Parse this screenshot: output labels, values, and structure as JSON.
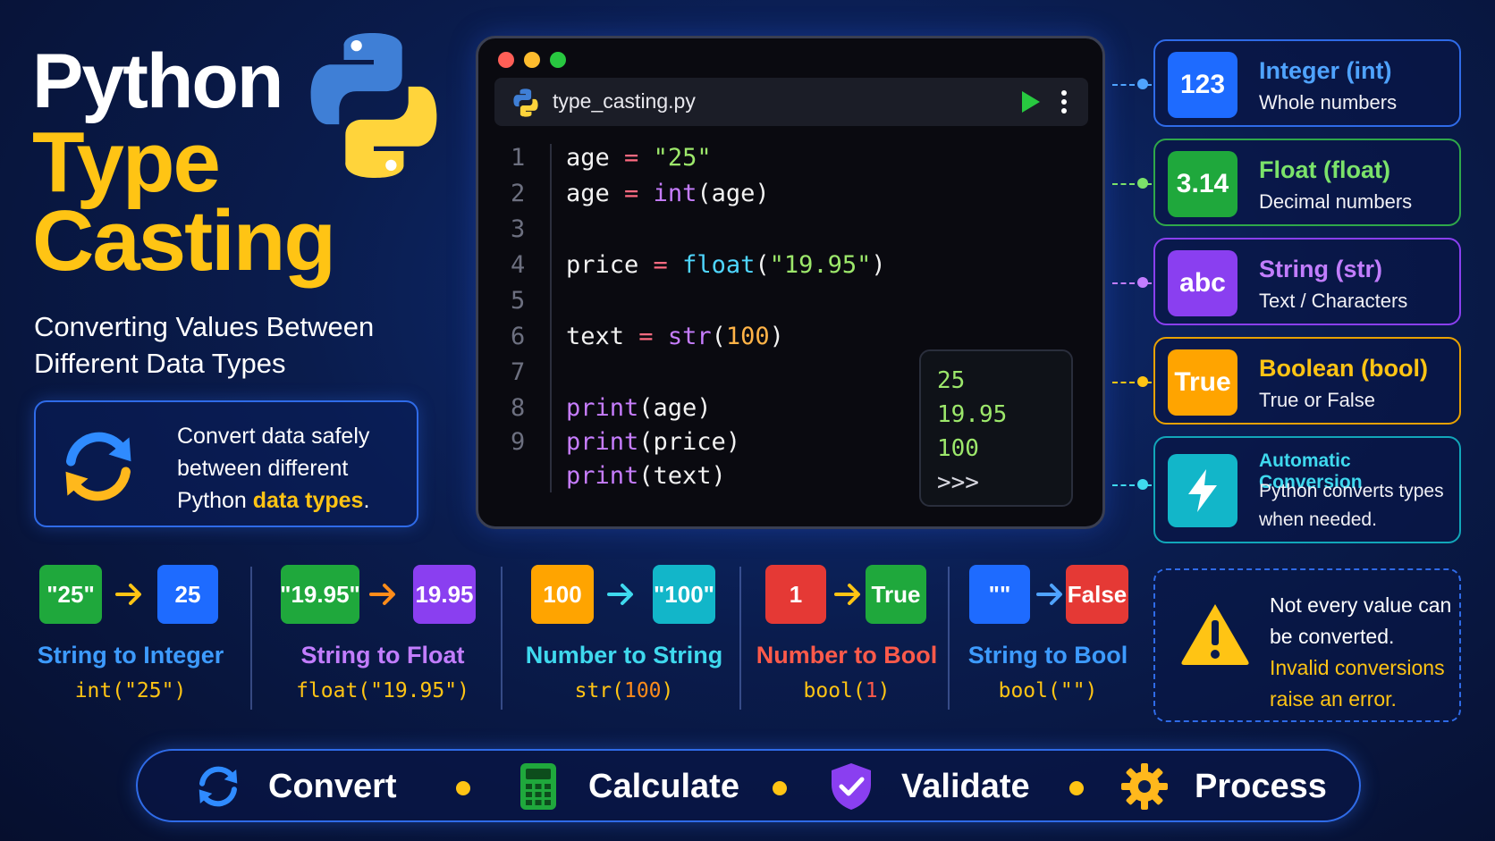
{
  "hero": {
    "title_line1": "Python",
    "title_line2": "Type",
    "title_line3": "Casting",
    "subtitle": "Converting Values Between Different Data Types",
    "info_pre": "Convert data safely between different Python ",
    "info_highlight": "data types",
    "info_post": ".",
    "logo_icon": "python-logo-icon",
    "sync_icon": "sync-arrows-icon"
  },
  "editor": {
    "filename": "type_casting.py",
    "line_numbers": [
      "1",
      "2",
      "3",
      "4",
      "5",
      "6",
      "7",
      "8",
      "9"
    ],
    "code": {
      "l1_var": "age",
      "l1_op": " = ",
      "l1_val": "\"25\"",
      "l2_var": "age",
      "l2_op": " = ",
      "l2_fn": "int",
      "l2_arg": "(age)",
      "l4_var": "price",
      "l4_op": " = ",
      "l4_fn": "float",
      "l4_open": "(",
      "l4_val": "\"19.95\"",
      "l4_close": ")",
      "l6_var": "text",
      "l6_op": " = ",
      "l6_fn": "str",
      "l6_open": "(",
      "l6_val": "100",
      "l6_close": ")",
      "l8_fn": "print",
      "l8_arg": "(age)",
      "l9_fn": "print",
      "l9_arg": "(price)",
      "l10_fn": "print",
      "l10_arg": "(text)"
    },
    "output": [
      "25",
      "19.95",
      "100",
      ">>>"
    ],
    "window_dots": [
      "#ff5f57",
      "#febc2e",
      "#28c840"
    ]
  },
  "types": [
    {
      "badge": "123",
      "name": "Integer (int)",
      "desc": "Whole numbers",
      "color": "#1e6bff",
      "accent": "#4fa3ff"
    },
    {
      "badge": "3.14",
      "name": "Float (float)",
      "desc": "Decimal numbers",
      "color": "#1fa83c",
      "accent": "#7be26a"
    },
    {
      "badge": "abc",
      "name": "String (str)",
      "desc": "Text / Characters",
      "color": "#8a3ff0",
      "accent": "#c27dff"
    },
    {
      "badge": "True",
      "name": "Boolean (bool)",
      "desc": "True or False",
      "color": "#ffa400",
      "accent": "#ffc414"
    },
    {
      "name": "Automatic Conversion",
      "desc1": "Python converts types",
      "desc2": "when needed.",
      "color": "#12b6c9",
      "accent": "#3fd9ee",
      "icon": "lightning-icon"
    }
  ],
  "conversions": [
    {
      "from": "\"25\"",
      "to": "25",
      "label": "String to Integer",
      "code": "int(\"25\")",
      "label_color": "#3d9bff"
    },
    {
      "from": "\"19.95\"",
      "to": "19.95",
      "label": "String to Float",
      "code": "float(\"19.95\")",
      "label_color": "#c27dff"
    },
    {
      "from": "100",
      "to": "\"100\"",
      "label": "Number to String",
      "code_fn": "str(",
      "code_arg": "100",
      "code_close": ")",
      "label_color": "#3fd9ee"
    },
    {
      "from": "1",
      "to": "True",
      "label": "Number to Bool",
      "code_fn": "bool(",
      "code_arg": "1",
      "code_close": ")",
      "label_color": "#ff5a4a"
    },
    {
      "from": "\"\"",
      "to": "False",
      "label": "String to Bool",
      "code": "bool(\"\")",
      "label_color": "#3d9bff"
    }
  ],
  "warning": {
    "line1": "Not every value can be converted.",
    "line2": "Invalid conversions raise an error.",
    "icon": "warning-triangle-icon"
  },
  "bottom_bar": [
    {
      "label": "Convert",
      "icon": "sync-arrows-icon"
    },
    {
      "label": "Calculate",
      "icon": "calculator-icon"
    },
    {
      "label": "Validate",
      "icon": "shield-check-icon"
    },
    {
      "label": "Process",
      "icon": "gear-icon"
    }
  ]
}
